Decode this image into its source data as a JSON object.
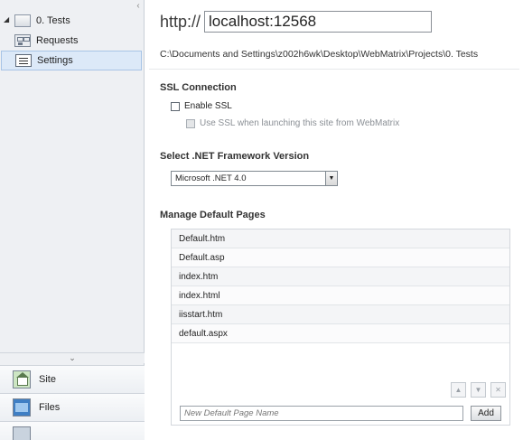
{
  "tree": {
    "root_label": "0. Tests",
    "items": [
      {
        "label": "Requests"
      },
      {
        "label": "Settings"
      }
    ]
  },
  "workspaces": [
    {
      "label": "Site",
      "icon": "house-icon"
    },
    {
      "label": "Files",
      "icon": "folder-icon"
    }
  ],
  "header": {
    "scheme": "http://",
    "url": "localhost:12568",
    "path": "C:\\Documents and Settings\\z002h6wk\\Desktop\\WebMatrix\\Projects\\0. Tests"
  },
  "ssl": {
    "title": "SSL Connection",
    "enable_label": "Enable SSL",
    "use_label": "Use SSL when launching this site from WebMatrix"
  },
  "framework": {
    "title": "Select .NET Framework Version",
    "selected": "Microsoft .NET 4.0"
  },
  "default_pages": {
    "title": "Manage Default Pages",
    "items": [
      "Default.htm",
      "Default.asp",
      "index.htm",
      "index.html",
      "iisstart.htm",
      "default.aspx"
    ],
    "new_placeholder": "New Default Page Name",
    "add_label": "Add"
  },
  "colors": {
    "selection_bg": "#dce9f8",
    "selection_border": "#a7c4e6",
    "left_pane_bg": "#eef0f3"
  }
}
